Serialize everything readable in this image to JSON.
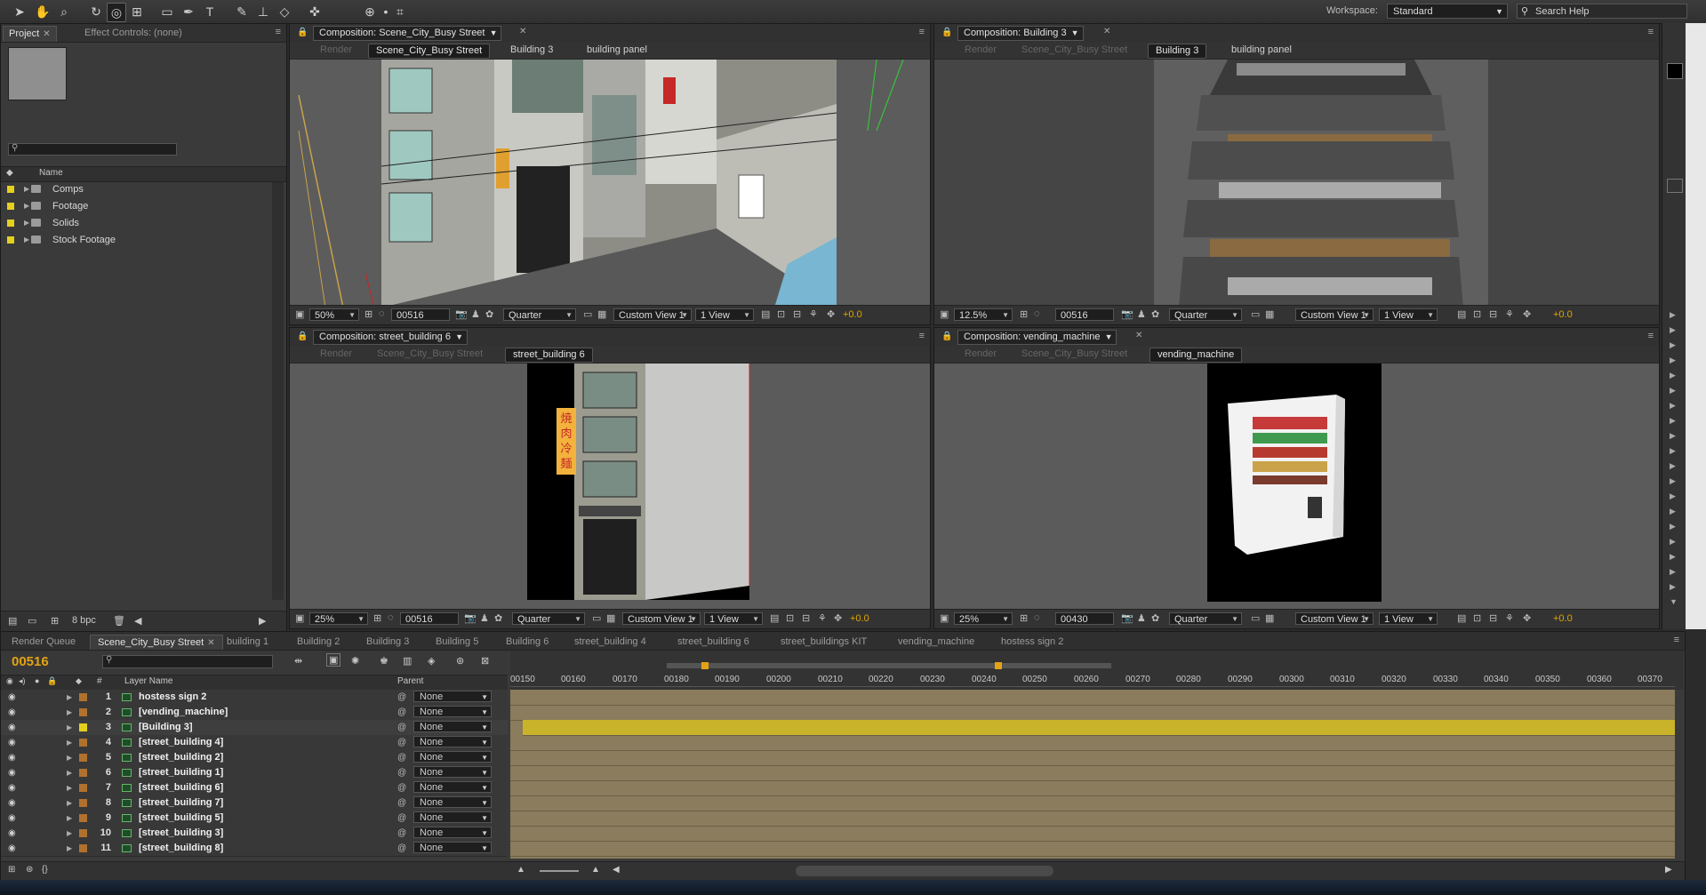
{
  "toolbar": {
    "tools": [
      "selection-arrow",
      "hand",
      "zoom",
      "rotate",
      "camera-orbit",
      "pan-behind",
      "rectangle",
      "pen",
      "type",
      "brush",
      "clone-stamp",
      "eraser",
      "puppet-pin",
      "axis-local",
      "axis-world",
      "axis-view"
    ],
    "workspace_label": "Workspace:",
    "workspace_value": "Standard",
    "search_help": "Search Help"
  },
  "project_panel": {
    "tab_project": "Project",
    "tab_effect_controls": "Effect Controls: (none)",
    "search_placeholder": "",
    "column_name": "Name",
    "items": [
      "Comps",
      "Footage",
      "Solids",
      "Stock Footage"
    ],
    "bpc": "8 bpc"
  },
  "viewers": [
    {
      "comp_select": "Composition: Scene_City_Busy Street",
      "crumbs": [
        "Render",
        "Scene_City_Busy Street",
        "Building 3",
        "building panel"
      ],
      "active_crumb": 1,
      "zoom": "50%",
      "timecode": "00516",
      "resolution": "Quarter",
      "view": "Custom View 1",
      "layout": "1 View",
      "exposure": "+0.0"
    },
    {
      "comp_select": "Composition: Building 3",
      "crumbs": [
        "Render",
        "Scene_City_Busy Street",
        "Building 3",
        "building panel"
      ],
      "active_crumb": 2,
      "zoom": "12.5%",
      "timecode": "00516",
      "resolution": "Quarter",
      "view": "Custom View 1",
      "layout": "1 View",
      "exposure": "+0.0"
    },
    {
      "comp_select": "Composition: street_building 6",
      "crumbs": [
        "Render",
        "Scene_City_Busy Street",
        "street_building 6"
      ],
      "active_crumb": 2,
      "zoom": "25%",
      "timecode": "00516",
      "resolution": "Quarter",
      "view": "Custom View 1",
      "layout": "1 View",
      "exposure": "+0.0"
    },
    {
      "comp_select": "Composition: vending_machine",
      "crumbs": [
        "Render",
        "Scene_City_Busy Street",
        "vending_machine"
      ],
      "active_crumb": 2,
      "zoom": "25%",
      "timecode": "00430",
      "resolution": "Quarter",
      "view": "Custom View 1",
      "layout": "1 View",
      "exposure": "+0.0"
    }
  ],
  "sign_text": "焼肉冷麺",
  "timeline": {
    "tabs": [
      "Render Queue",
      "Scene_City_Busy Street",
      "building 1",
      "Building 2",
      "Building 3",
      "Building 5",
      "Building 6",
      "street_building 4",
      "street_building 6",
      "street_buildings KIT",
      "vending_machine",
      "hostess sign 2"
    ],
    "active_tab": 1,
    "current_time": "00516",
    "col_layer_name": "Layer Name",
    "col_parent": "Parent",
    "col_hash": "#",
    "ruler_ticks": [
      "00150",
      "00160",
      "00170",
      "00180",
      "00190",
      "00200",
      "00210",
      "00220",
      "00230",
      "00240",
      "00250",
      "00260",
      "00270",
      "00280",
      "00290",
      "00300",
      "00310",
      "00320",
      "00330",
      "00340",
      "00350",
      "00360",
      "00370"
    ],
    "layers": [
      {
        "num": "1",
        "name": "hostess sign 2",
        "parent": "None",
        "label_color": "#b0712e"
      },
      {
        "num": "2",
        "name": "[vending_machine]",
        "parent": "None",
        "label_color": "#b0712e"
      },
      {
        "num": "3",
        "name": "[Building 3]",
        "parent": "None",
        "label_color": "#e5d01e"
      },
      {
        "num": "4",
        "name": "[street_building 4]",
        "parent": "None",
        "label_color": "#b0712e"
      },
      {
        "num": "5",
        "name": "[street_building 2]",
        "parent": "None",
        "label_color": "#b0712e"
      },
      {
        "num": "6",
        "name": "[street_building 1]",
        "parent": "None",
        "label_color": "#b0712e"
      },
      {
        "num": "7",
        "name": "[street_building 6]",
        "parent": "None",
        "label_color": "#b0712e"
      },
      {
        "num": "8",
        "name": "[street_building 7]",
        "parent": "None",
        "label_color": "#b0712e"
      },
      {
        "num": "9",
        "name": "[street_building 5]",
        "parent": "None",
        "label_color": "#b0712e"
      },
      {
        "num": "10",
        "name": "[street_building 3]",
        "parent": "None",
        "label_color": "#b0712e"
      },
      {
        "num": "11",
        "name": "[street_building 8]",
        "parent": "None",
        "label_color": "#b0712e"
      }
    ]
  }
}
